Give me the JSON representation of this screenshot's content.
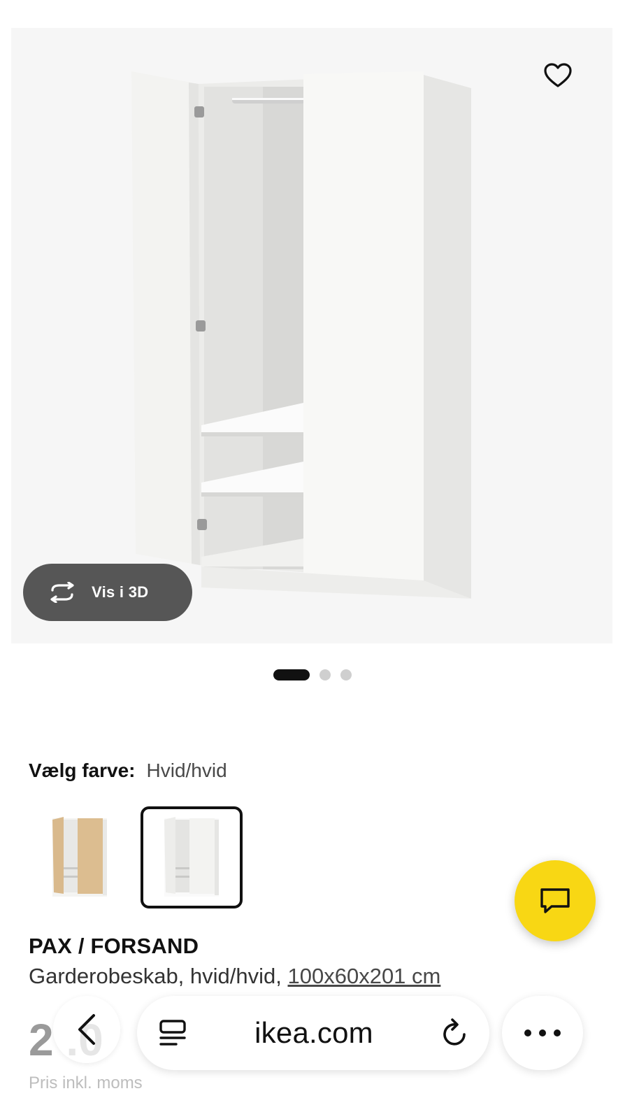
{
  "view3d": {
    "label": "Vis i 3D"
  },
  "gallery": {
    "total": 3,
    "active_index": 1
  },
  "color": {
    "label": "Vælg farve:",
    "selected": "Hvid/hvid",
    "options": [
      {
        "name": "oak-effect-white",
        "selected": false
      },
      {
        "name": "white-white",
        "selected": true
      }
    ]
  },
  "product": {
    "name": "PAX / FORSAND",
    "description": "Garderobeskab, hvid/hvid,",
    "dimensions": "100x60x201 cm",
    "price_visible": "2 .0",
    "price_note": "Pris inkl. moms"
  },
  "browser": {
    "url": "ikea.com",
    "icons": [
      "back-icon",
      "reader-icon",
      "reload-icon",
      "more-icon"
    ]
  },
  "colors": {
    "brand_yellow": "#f8d714",
    "dark_button": "#484848"
  }
}
